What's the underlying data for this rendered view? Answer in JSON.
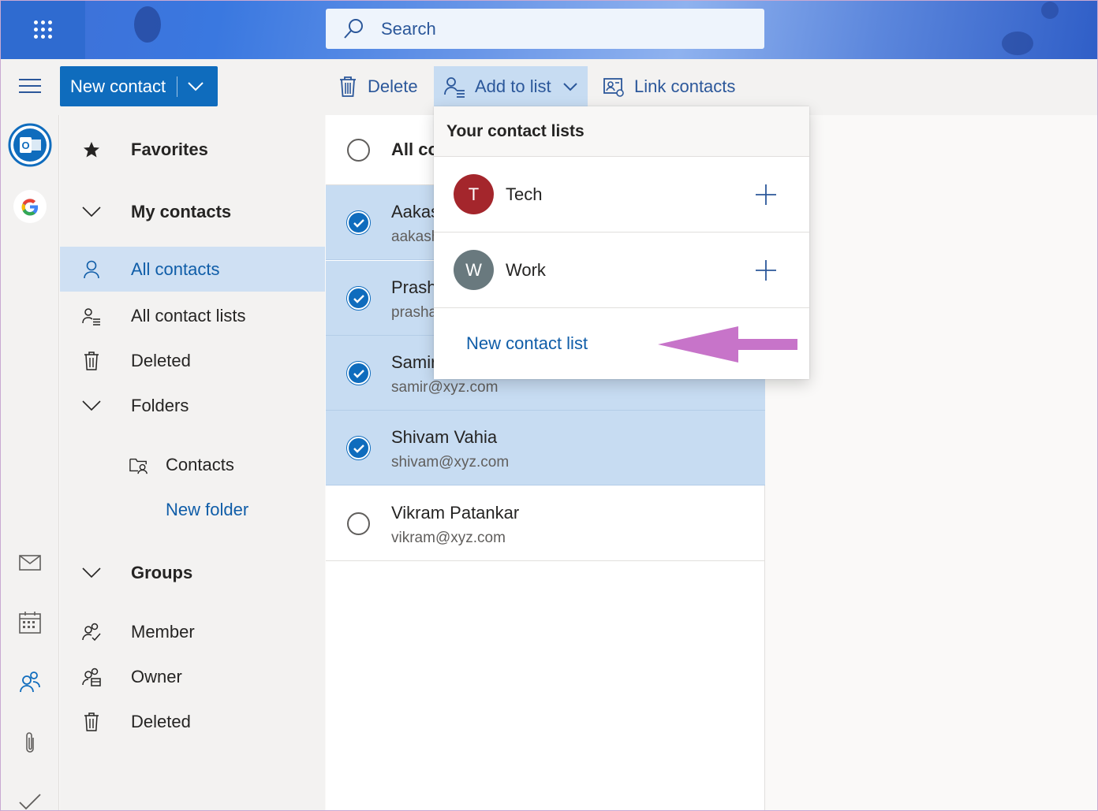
{
  "search": {
    "placeholder": "Search"
  },
  "toolbar": {
    "new_contact": "New contact",
    "delete": "Delete",
    "add_to_list": "Add to list",
    "link_contacts": "Link contacts"
  },
  "rail": {
    "apps": [
      "outlook-icon",
      "google-icon"
    ],
    "modules": [
      "mail-icon",
      "calendar-icon",
      "people-icon",
      "attachment-icon",
      "todo-icon"
    ],
    "active": "people-icon"
  },
  "nav": {
    "favorites": "Favorites",
    "my_contacts": "My contacts",
    "all_contacts": "All contacts",
    "all_contact_lists": "All contact lists",
    "deleted": "Deleted",
    "folders": "Folders",
    "contacts_folder": "Contacts",
    "new_folder": "New folder",
    "groups": "Groups",
    "member": "Member",
    "owner": "Owner",
    "groups_deleted": "Deleted"
  },
  "list": {
    "header": "All co",
    "contacts": [
      {
        "name": "Aakas",
        "email": "aakash",
        "selected": true
      },
      {
        "name": "Prash",
        "email": "prasha",
        "selected": true
      },
      {
        "name": "Samir",
        "email": "samir@xyz.com",
        "selected": true
      },
      {
        "name": "Shivam Vahia",
        "email": "shivam@xyz.com",
        "selected": true
      },
      {
        "name": "Vikram Patankar",
        "email": "vikram@xyz.com",
        "selected": false
      }
    ]
  },
  "dropdown": {
    "title": "Your contact lists",
    "lists": [
      {
        "initial": "T",
        "name": "Tech",
        "color": "#a4262c"
      },
      {
        "initial": "W",
        "name": "Work",
        "color": "#69797e"
      }
    ],
    "new_list": "New contact list"
  },
  "colors": {
    "accent": "#0f6cbd",
    "selected_row": "#c7dcf2",
    "annotation_arrow": "#c774c9"
  }
}
